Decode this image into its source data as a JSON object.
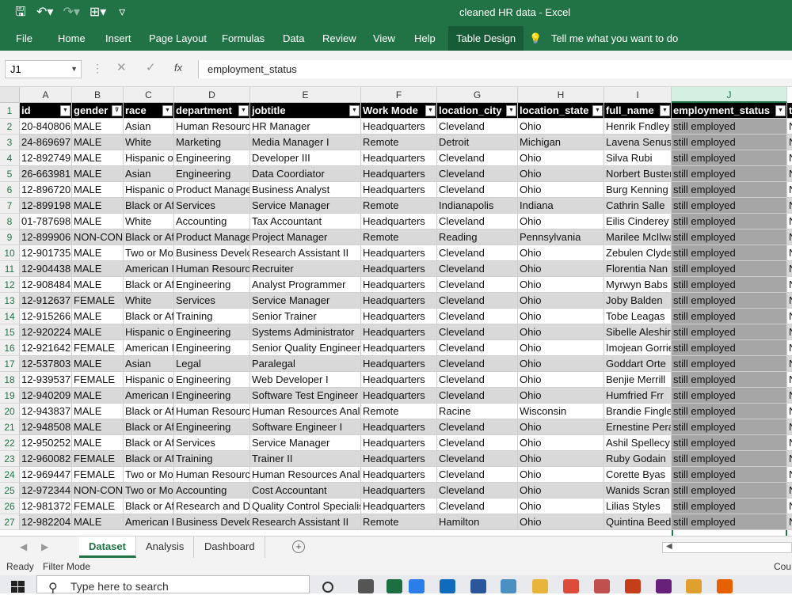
{
  "titlebar": {
    "title": "cleaned HR data  -  Excel",
    "qat_icons": [
      "save-icon",
      "undo-icon",
      "redo-icon",
      "touch-mode-icon",
      "customize-qat-icon"
    ],
    "qat_glyphs": [
      "🖫",
      "↶▾",
      "↷▾",
      "⊞▾",
      "▿"
    ]
  },
  "ribbon": {
    "tabs": [
      "File",
      "Home",
      "Insert",
      "Page Layout",
      "Formulas",
      "Data",
      "Review",
      "View",
      "Help",
      "Table Design"
    ],
    "active_tab": "Table Design",
    "tell_me": "Tell me what you want to do"
  },
  "formula_bar": {
    "name_box": "J1",
    "formula": "employment_status",
    "cancel_glyph": "✕",
    "enter_glyph": "✓",
    "fx_glyph": "fx"
  },
  "columns": [
    "A",
    "B",
    "C",
    "D",
    "E",
    "F",
    "G",
    "H",
    "I",
    "J"
  ],
  "selected_column": "J",
  "headers": [
    "id",
    "gender",
    "race",
    "department",
    "jobtitle",
    "Work Mode",
    "location_city",
    "location_state",
    "full_name",
    "employment_status",
    "t"
  ],
  "rows": [
    [
      "1",
      "",
      "",
      "",
      "",
      "",
      "",
      "",
      "",
      "",
      ""
    ],
    [
      "2",
      "20-840806",
      "MALE",
      "Asian",
      "Human Resources",
      "HR Manager",
      "Headquarters",
      "Cleveland",
      "Ohio",
      "Henrik Fndley",
      "still employed"
    ],
    [
      "3",
      "24-869697",
      "MALE",
      "White",
      "Marketing",
      "Media Manager I",
      "Remote",
      "Detroit",
      "Michigan",
      "Lavena Senuse",
      "still employed"
    ],
    [
      "4",
      "12-892749",
      "MALE",
      "Hispanic or Latino",
      "Engineering",
      "Developer III",
      "Headquarters",
      "Cleveland",
      "Ohio",
      "Silva Rubi",
      "still employed"
    ],
    [
      "5",
      "26-663981",
      "MALE",
      "Asian",
      "Engineering",
      "Data Coordiator",
      "Headquarters",
      "Cleveland",
      "Ohio",
      "Norbert Buster",
      "still employed"
    ],
    [
      "6",
      "12-896720",
      "MALE",
      "Hispanic or Latino",
      "Product Management",
      "Business Analyst",
      "Headquarters",
      "Cleveland",
      "Ohio",
      "Burg Kenning",
      "still employed"
    ],
    [
      "7",
      "12-899198",
      "MALE",
      "Black or African American",
      "Services",
      "Service Manager",
      "Remote",
      "Indianapolis",
      "Indiana",
      "Cathrin Salle",
      "still employed"
    ],
    [
      "8",
      "01-787698",
      "MALE",
      "White",
      "Accounting",
      "Tax Accountant",
      "Headquarters",
      "Cleveland",
      "Ohio",
      "Eilis Cinderey",
      "still employed"
    ],
    [
      "9",
      "12-899906",
      "NON-CONFORMING",
      "Black or African American",
      "Product Management",
      "Project Manager",
      "Remote",
      "Reading",
      "Pennsylvania",
      "Marilee McIlwain",
      "still employed"
    ],
    [
      "10",
      "12-901735",
      "MALE",
      "Two or More Races",
      "Business Development",
      "Research Assistant II",
      "Headquarters",
      "Cleveland",
      "Ohio",
      "Zebulen Clyde",
      "still employed"
    ],
    [
      "11",
      "12-904438",
      "MALE",
      "American Indian",
      "Human Resources",
      "Recruiter",
      "Headquarters",
      "Cleveland",
      "Ohio",
      "Florentia Nan",
      "still employed"
    ],
    [
      "12",
      "12-908484",
      "MALE",
      "Black or African American",
      "Engineering",
      "Analyst Programmer",
      "Headquarters",
      "Cleveland",
      "Ohio",
      "Myrwyn Babs",
      "still employed"
    ],
    [
      "13",
      "12-912637",
      "FEMALE",
      "White",
      "Services",
      "Service Manager",
      "Headquarters",
      "Cleveland",
      "Ohio",
      "Joby Balden",
      "still employed"
    ],
    [
      "14",
      "12-915266",
      "MALE",
      "Black or African American",
      "Training",
      "Senior Trainer",
      "Headquarters",
      "Cleveland",
      "Ohio",
      "Tobe Leagas",
      "still employed"
    ],
    [
      "15",
      "12-920224",
      "MALE",
      "Hispanic or Latino",
      "Engineering",
      "Systems Administrator",
      "Headquarters",
      "Cleveland",
      "Ohio",
      "Sibelle Aleshire",
      "still employed"
    ],
    [
      "16",
      "12-921642",
      "FEMALE",
      "American Indian",
      "Engineering",
      "Senior Quality Engineer",
      "Headquarters",
      "Cleveland",
      "Ohio",
      "Imojean Gorrie",
      "still employed"
    ],
    [
      "17",
      "12-537803",
      "MALE",
      "Asian",
      "Legal",
      "Paralegal",
      "Headquarters",
      "Cleveland",
      "Ohio",
      "Goddart Orte",
      "still employed"
    ],
    [
      "18",
      "12-939537",
      "FEMALE",
      "Hispanic or Latino",
      "Engineering",
      "Web Developer I",
      "Headquarters",
      "Cleveland",
      "Ohio",
      "Benjie Merrill",
      "still employed"
    ],
    [
      "19",
      "12-940209",
      "MALE",
      "American Indian",
      "Engineering",
      "Software Test Engineer",
      "Headquarters",
      "Cleveland",
      "Ohio",
      "Humfried Frr",
      "still employed"
    ],
    [
      "20",
      "12-943837",
      "MALE",
      "Black or African American",
      "Human Resources",
      "Human Resources Analyst",
      "Remote",
      "Racine",
      "Wisconsin",
      "Brandie Fingleton",
      "still employed"
    ],
    [
      "21",
      "12-948508",
      "MALE",
      "Black or African American",
      "Engineering",
      "Software Engineer I",
      "Headquarters",
      "Cleveland",
      "Ohio",
      "Ernestine Pera",
      "still employed"
    ],
    [
      "22",
      "12-950252",
      "MALE",
      "Black or African American",
      "Services",
      "Service Manager",
      "Headquarters",
      "Cleveland",
      "Ohio",
      "Ashil Spellecy",
      "still employed"
    ],
    [
      "23",
      "12-960082",
      "FEMALE",
      "Black or African American",
      "Training",
      "Trainer II",
      "Headquarters",
      "Cleveland",
      "Ohio",
      "Ruby Godain",
      "still employed"
    ],
    [
      "24",
      "12-969447",
      "FEMALE",
      "Two or More Races",
      "Human Resources",
      "Human Resources Analyst",
      "Headquarters",
      "Cleveland",
      "Ohio",
      "Corette Byas",
      "still employed"
    ],
    [
      "25",
      "12-972344",
      "NON-CONFORMING",
      "Two or More Races",
      "Accounting",
      "Cost Accountant",
      "Headquarters",
      "Cleveland",
      "Ohio",
      "Wanids Scran",
      "still employed"
    ],
    [
      "26",
      "12-981372",
      "FEMALE",
      "Black or African American",
      "Research and Development",
      "Quality Control Specialist",
      "Headquarters",
      "Cleveland",
      "Ohio",
      "Lilias Styles",
      "still employed"
    ],
    [
      "27",
      "12-982204",
      "MALE",
      "American Indian",
      "Business Development",
      "Research Assistant II",
      "Remote",
      "Hamilton",
      "Ohio",
      "Quintina Beedell",
      "still employed"
    ]
  ],
  "overflow_col_glyph": "N",
  "sheets": [
    "Dataset",
    "Analysis",
    "Dashboard"
  ],
  "active_sheet": "Dataset",
  "add_sheet_glyph": "+",
  "status": {
    "ready": "Ready",
    "mode": "Filter Mode",
    "right": "Cou"
  },
  "taskbar": {
    "search_placeholder": "Type here to search",
    "icons": [
      "cortana-icon",
      "task-view-icon",
      "excel-icon",
      "edge-icon",
      "mail-icon",
      "word-icon",
      "notepad-icon",
      "file-explorer-icon",
      "chrome-icon",
      "paint-icon",
      "powerpoint-icon",
      "visual-studio-icon",
      "ms-paint-3d-icon",
      "firefox-icon"
    ]
  },
  "colors": {
    "excel_green": "#217346",
    "header_black": "#000000",
    "band_gray": "#d9d9d9",
    "selected_col": "#a6a6a6"
  }
}
